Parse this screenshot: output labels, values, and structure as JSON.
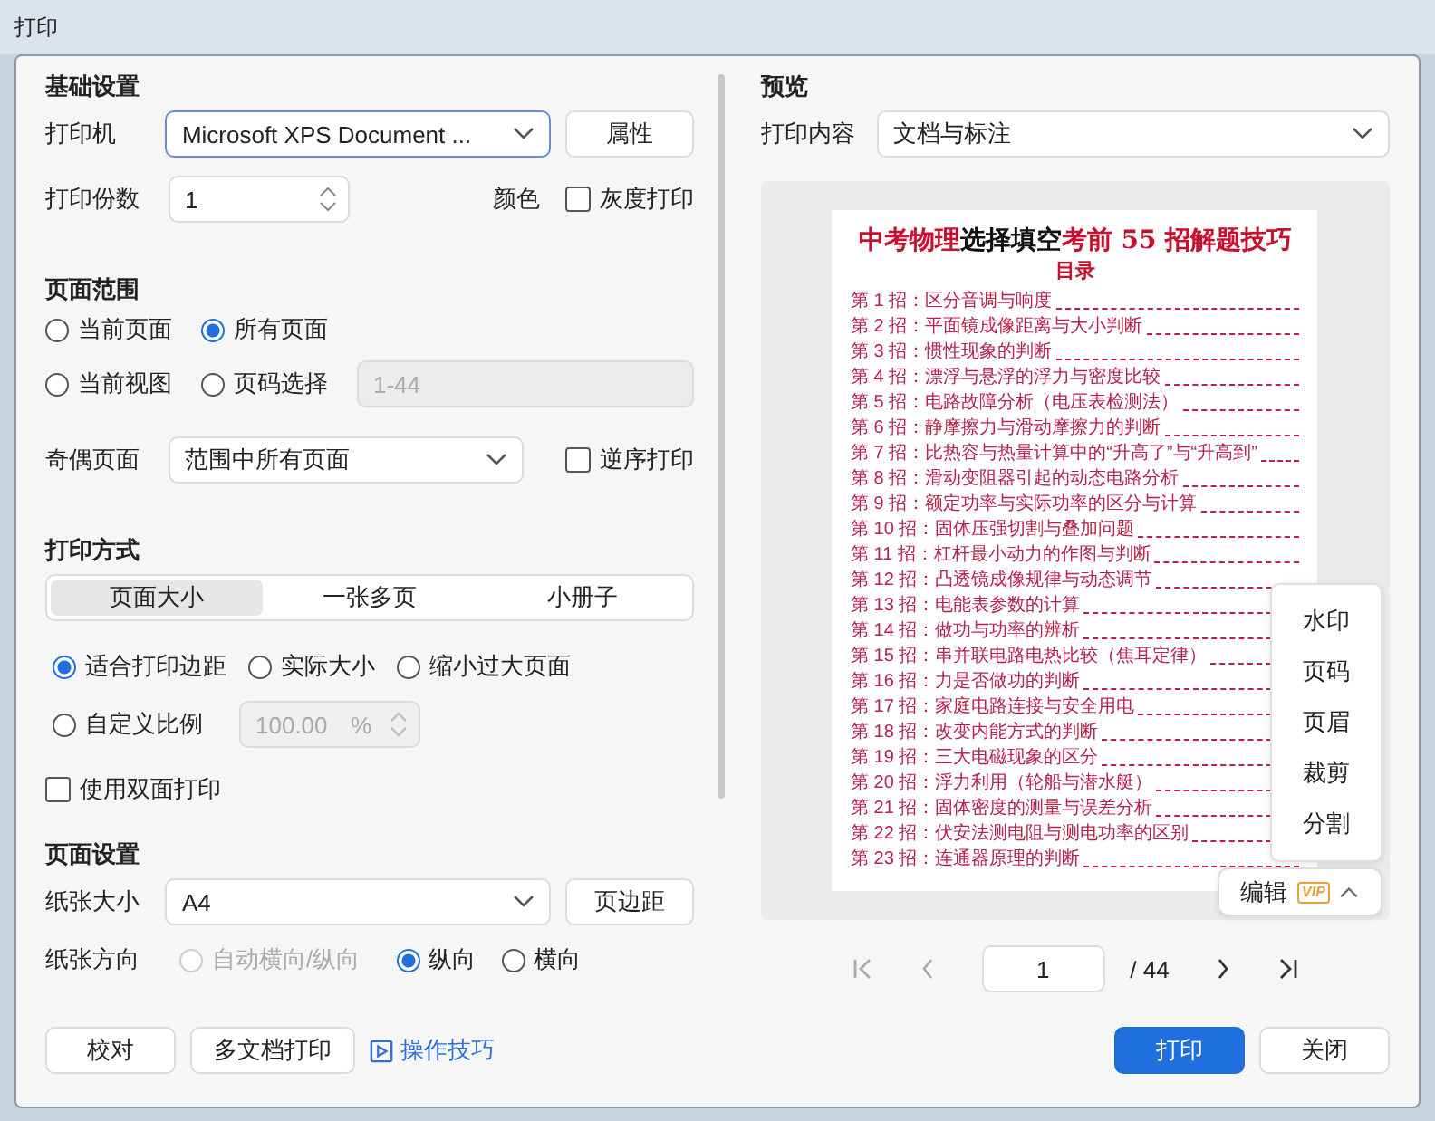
{
  "window": {
    "title": "打印"
  },
  "basic": {
    "heading": "基础设置",
    "printer": {
      "label": "打印机",
      "value": "Microsoft XPS Document ...",
      "button": "属性"
    },
    "copies": {
      "label": "打印份数",
      "value": "1"
    },
    "color": {
      "label": "颜色",
      "option": "灰度打印",
      "checked": false
    }
  },
  "page_range": {
    "heading": "页面范围",
    "options": [
      {
        "label": "当前页面",
        "selected": false
      },
      {
        "label": "所有页面",
        "selected": true
      },
      {
        "label": "当前视图",
        "selected": false
      },
      {
        "label": "页码选择",
        "selected": false
      }
    ],
    "pages_field": {
      "placeholder": "1-44",
      "disabled": true
    }
  },
  "odd_even": {
    "label": "奇偶页面",
    "value": "范围中所有页面",
    "reverse": {
      "label": "逆序打印",
      "checked": false
    }
  },
  "print_mode": {
    "heading": "打印方式",
    "tabs": [
      {
        "label": "页面大小",
        "selected": true
      },
      {
        "label": "一张多页",
        "selected": false
      },
      {
        "label": "小册子",
        "selected": false
      }
    ],
    "scale_options": [
      {
        "label": "适合打印边距",
        "selected": true
      },
      {
        "label": "实际大小",
        "selected": false
      },
      {
        "label": "缩小过大页面",
        "selected": false
      },
      {
        "label": "自定义比例",
        "selected": false
      }
    ],
    "custom_scale": {
      "value": "100.00",
      "unit": "%",
      "disabled": true
    },
    "duplex": {
      "label": "使用双面打印",
      "checked": false
    }
  },
  "page_setup": {
    "heading": "页面设置",
    "paper_size": {
      "label": "纸张大小",
      "value": "A4",
      "button": "页边距"
    },
    "orientation": {
      "label": "纸张方向",
      "options": [
        {
          "label": "自动横向/纵向",
          "selected": false,
          "disabled": true
        },
        {
          "label": "纵向",
          "selected": true,
          "disabled": false
        },
        {
          "label": "横向",
          "selected": false,
          "disabled": false
        }
      ]
    }
  },
  "footer_left": {
    "buttons": [
      "校对",
      "多文档打印"
    ],
    "link": "操作技巧"
  },
  "preview": {
    "heading": "预览",
    "content": {
      "label": "打印内容",
      "value": "文档与标注"
    },
    "document": {
      "title": [
        {
          "text": "中考物理",
          "color": "#c8102e"
        },
        {
          "text": "选择填空",
          "color": "#111111"
        },
        {
          "text": "考前 55 招解题技巧",
          "color": "#c8102e"
        }
      ],
      "subtitle": "目录",
      "entries": [
        "第 1 招：区分音调与响度",
        "第 2 招：平面镜成像距离与大小判断",
        "第 3 招：惯性现象的判断",
        "第 4 招：漂浮与悬浮的浮力与密度比较",
        "第 5 招：电路故障分析（电压表检测法）",
        "第 6 招：静摩擦力与滑动摩擦力的判断",
        "第 7 招：比热容与热量计算中的“升高了”与“升高到”",
        "第 8 招：滑动变阻器引起的动态电路分析",
        "第 9 招：额定功率与实际功率的区分与计算",
        "第 10 招：固体压强切割与叠加问题",
        "第 11 招：杠杆最小动力的作图与判断",
        "第 12 招：凸透镜成像规律与动态调节",
        "第 13 招：电能表参数的计算",
        "第 14 招：做功与功率的辨析",
        "第 15 招：串并联电路电热比较（焦耳定律）",
        "第 16 招：力是否做功的判断",
        "第 17 招：家庭电路连接与安全用电",
        "第 18 招：改变内能方式的判断",
        "第 19 招：三大电磁现象的区分",
        "第 20 招：浮力利用（轮船与潜水艇）",
        "第 21 招：固体密度的测量与误差分析",
        "第 22 招：伏安法测电阻与测电功率的区别",
        "第 23 招：连通器原理的判断"
      ]
    },
    "edit_menu": {
      "expanded": true,
      "items": [
        "水印",
        "页码",
        "页眉",
        "裁剪",
        "分割"
      ]
    },
    "edit_button": {
      "label": "编辑",
      "badge": "VIP"
    },
    "pager": {
      "page": "1",
      "total": "/ 44"
    }
  },
  "actions": [
    {
      "label": "打印",
      "kind": "primary"
    },
    {
      "label": "关闭",
      "kind": "default"
    }
  ]
}
